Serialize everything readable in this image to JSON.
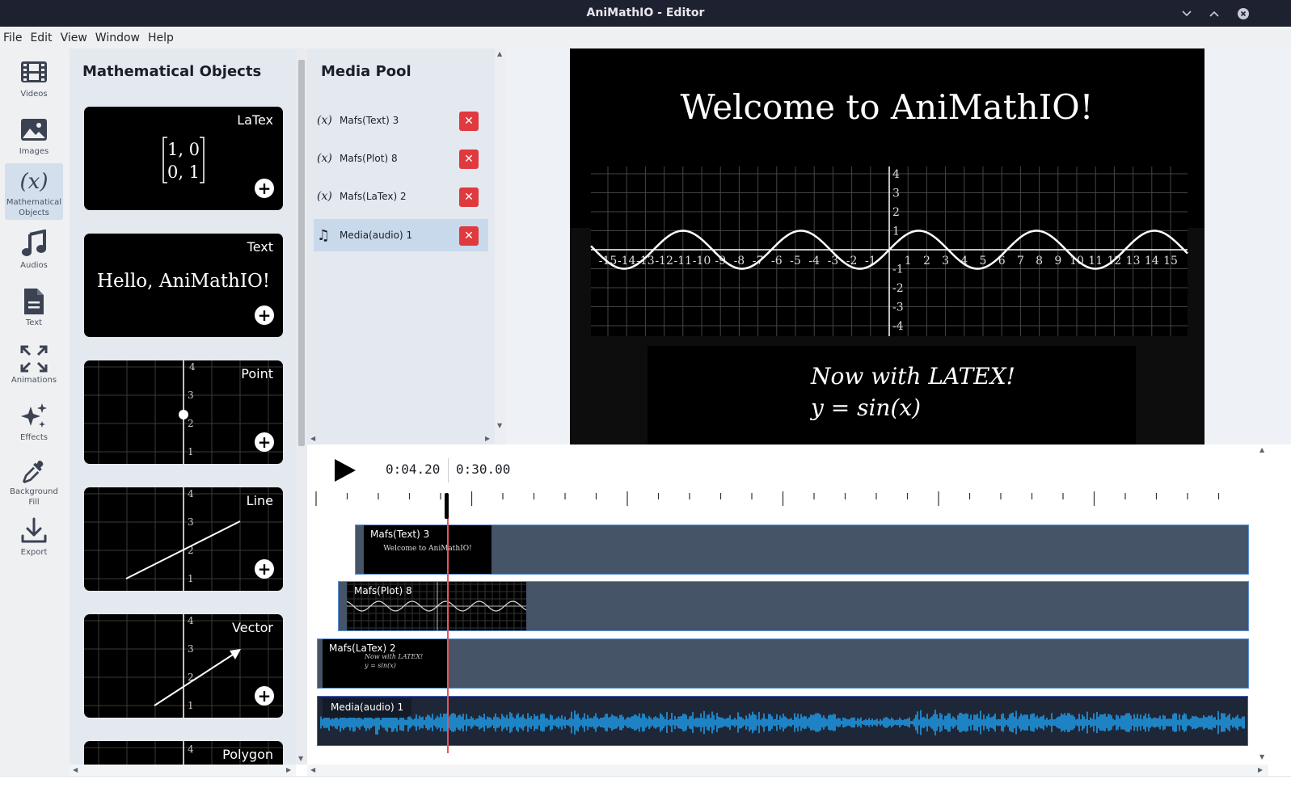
{
  "window": {
    "title": "AniMathIO - Editor",
    "controls": [
      "minimize-icon",
      "maximize-icon",
      "close-icon"
    ]
  },
  "menu": [
    "File",
    "Edit",
    "View",
    "Window",
    "Help"
  ],
  "sidebar": {
    "items": [
      {
        "label": "Videos",
        "icon": "film-icon"
      },
      {
        "label": "Images",
        "icon": "image-icon"
      },
      {
        "label": "Mathematical Objects",
        "icon": "function-x-icon",
        "active": true
      },
      {
        "label": "Audios",
        "icon": "music-note-icon"
      },
      {
        "label": "Text",
        "icon": "document-icon"
      },
      {
        "label": "Animations",
        "icon": "expand-arrows-icon"
      },
      {
        "label": "Effects",
        "icon": "sparkles-icon"
      },
      {
        "label": "Background Fill",
        "icon": "eyedropper-icon"
      },
      {
        "label": "Export",
        "icon": "download-icon"
      }
    ]
  },
  "math_objects": {
    "title": "Mathematical Objects",
    "cards": [
      {
        "label": "LaTex",
        "content": [
          "1, 0",
          "0, 1"
        ]
      },
      {
        "label": "Text",
        "content": "Hello, AniMathIO!"
      },
      {
        "label": "Point",
        "ticks": [
          "4",
          "3",
          "2",
          "1"
        ]
      },
      {
        "label": "Line",
        "ticks": [
          "4",
          "3",
          "2",
          "1"
        ]
      },
      {
        "label": "Vector",
        "ticks": [
          "4",
          "3",
          "2",
          "1"
        ]
      },
      {
        "label": "Polygon",
        "ticks": [
          "4"
        ]
      }
    ]
  },
  "media_pool": {
    "title": "Media Pool",
    "items": [
      {
        "icon": "(x)",
        "label": "Mafs(Text) 3",
        "selected": false
      },
      {
        "icon": "(x)",
        "label": "Mafs(Plot) 8",
        "selected": false
      },
      {
        "icon": "(x)",
        "label": "Mafs(LaTex) 2",
        "selected": false
      },
      {
        "icon": "♫",
        "label": "Media(audio) 1",
        "selected": true
      }
    ]
  },
  "preview": {
    "heading": "Welcome to AniMathIO!",
    "latex_line1": "Now with LATEX!",
    "latex_line2": "y = sin(x)",
    "plot": {
      "x_ticks": [
        "-15",
        "-14",
        "-13",
        "-12",
        "-11",
        "-10",
        "-9",
        "-8",
        "-7",
        "-6",
        "-5",
        "-4",
        "-3",
        "-2",
        "-1",
        "1",
        "2",
        "3",
        "4",
        "5",
        "6",
        "7",
        "8",
        "9",
        "10",
        "11",
        "12",
        "13",
        "14",
        "15"
      ],
      "y_ticks": [
        "4",
        "3",
        "2",
        "1",
        "-1",
        "-2",
        "-3",
        "-4"
      ]
    }
  },
  "timeline": {
    "current_time": "0:04.20",
    "total_time": "0:30.00",
    "play_icon": "play-icon",
    "tracks": [
      {
        "label": "Mafs(Text) 3",
        "thumb_text": "Welcome to AniMathIO!"
      },
      {
        "label": "Mafs(Plot) 8"
      },
      {
        "label": "Mafs(LaTex) 2",
        "thumb_lines": [
          "Now with LATEX!",
          "y = sin(x)"
        ]
      },
      {
        "label": "Media(audio) 1"
      }
    ]
  },
  "colors": {
    "titlebar": "#1e2130",
    "panel": "#e4e9f0",
    "track": "#465468",
    "waveform": "#1e9be8",
    "playhead": "#e4555a",
    "delete": "#e0393e"
  }
}
